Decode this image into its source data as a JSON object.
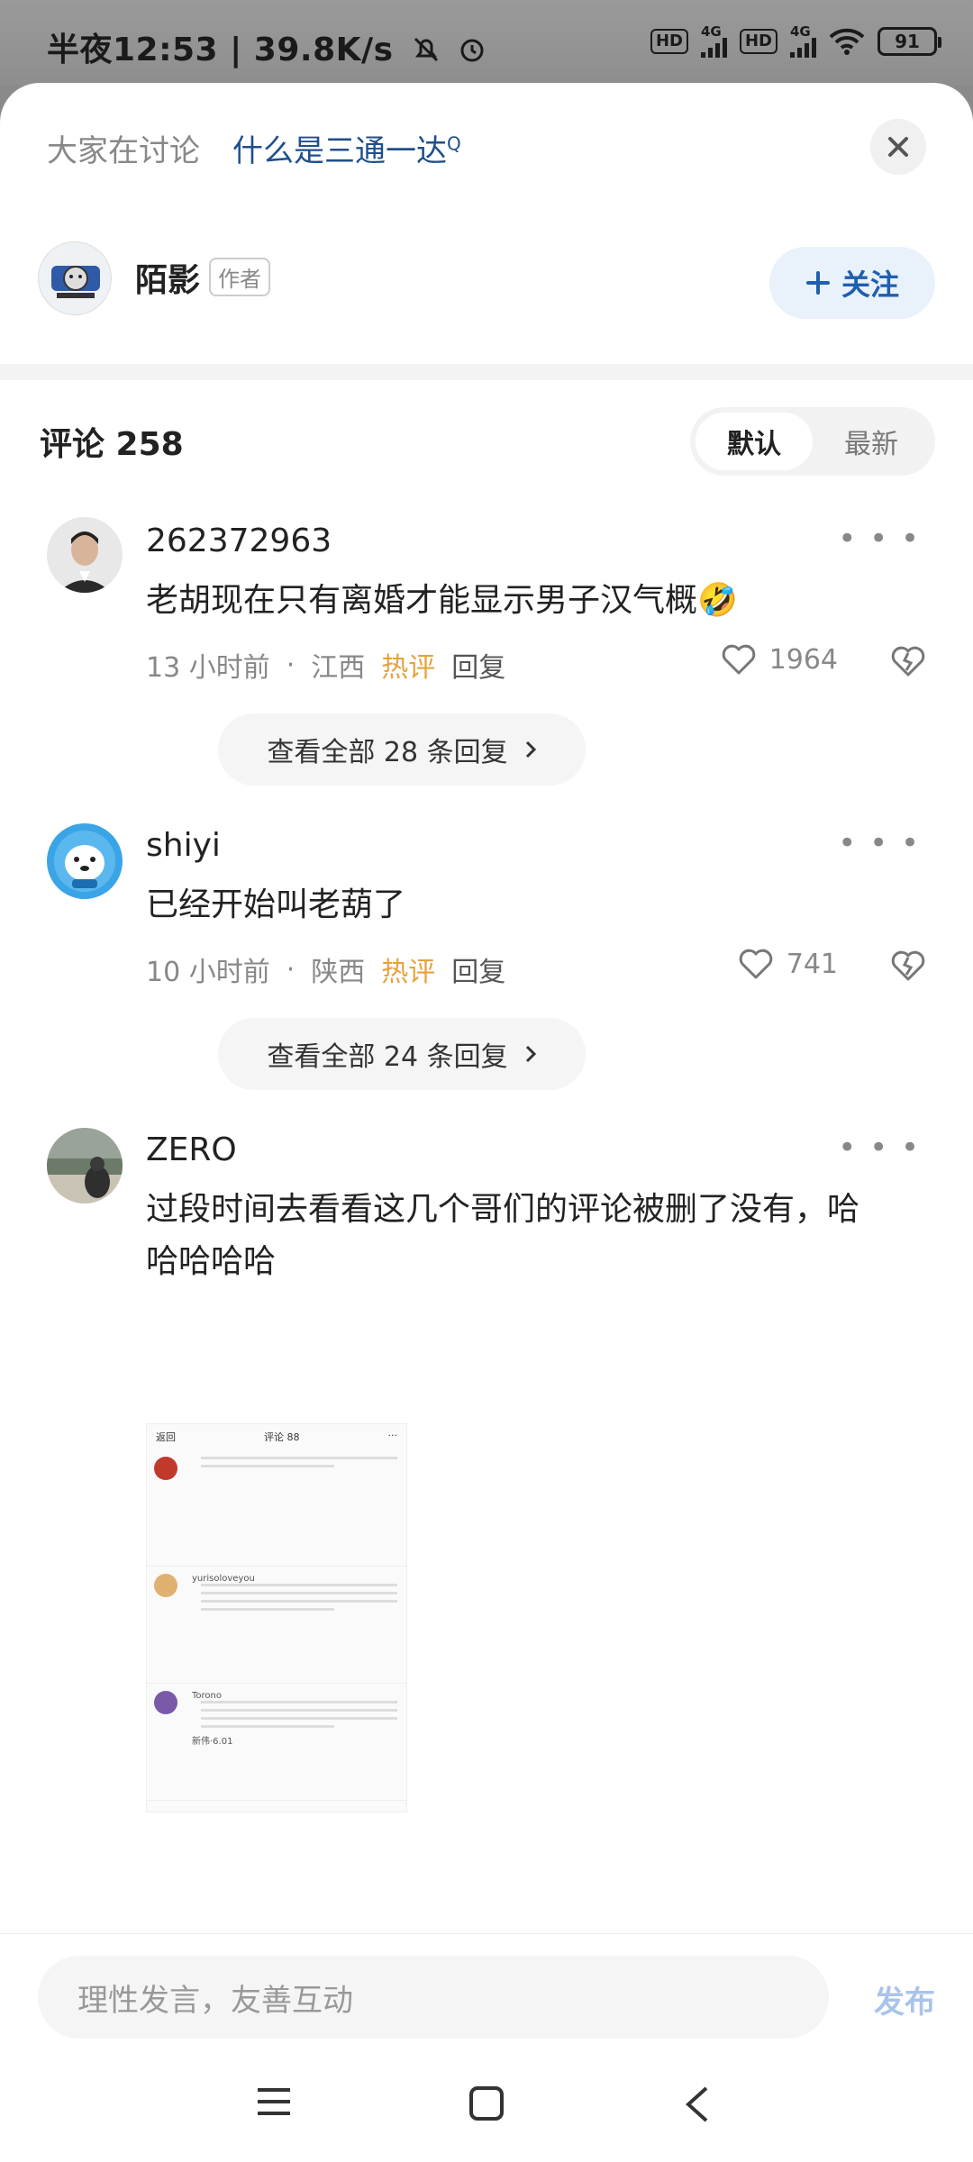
{
  "status_bar": {
    "time": "半夜12:53 | 39.8K/s",
    "hd1": "HD",
    "net1": "4G",
    "hd2": "HD",
    "net2": "4G",
    "battery": "91"
  },
  "header": {
    "discussing_label": "大家在讨论",
    "topic": "什么是三通一达",
    "search_mark": "Q"
  },
  "author": {
    "name": "陌影",
    "tag": "作者",
    "follow_label": "关注"
  },
  "comments_section": {
    "title": "评论 258",
    "sort_default": "默认",
    "sort_latest": "最新"
  },
  "comments": [
    {
      "user": "262372963",
      "text": "老胡现在只有离婚才能显示男子汉气概🤣",
      "time": "13 小时前",
      "region": "江西",
      "hot": "热评",
      "reply": "回复",
      "likes": "1964",
      "replies_link": "查看全部 28 条回复"
    },
    {
      "user": "shiyi",
      "text": "已经开始叫老葫了",
      "time": "10 小时前",
      "region": "陕西",
      "hot": "热评",
      "reply": "回复",
      "likes": "741",
      "replies_link": "查看全部 24 条回复"
    },
    {
      "user": "ZERO",
      "text_line1": "过段时间去看看这几个哥们的评论被删了没有，哈",
      "text_line2": "哈哈哈哈"
    }
  ],
  "embedded_screenshot": {
    "back": "返回",
    "title": "评论 88",
    "users": [
      "yurisoloveyou",
      "Torono",
      "新伟·6.01"
    ]
  },
  "input": {
    "placeholder": "理性发言，友善互动",
    "publish_label": "发布"
  },
  "colors": {
    "topic": "#1f4f8c",
    "follow": "#1f5fae",
    "hot": "#e6a23c",
    "publish": "#a9c4ea"
  }
}
